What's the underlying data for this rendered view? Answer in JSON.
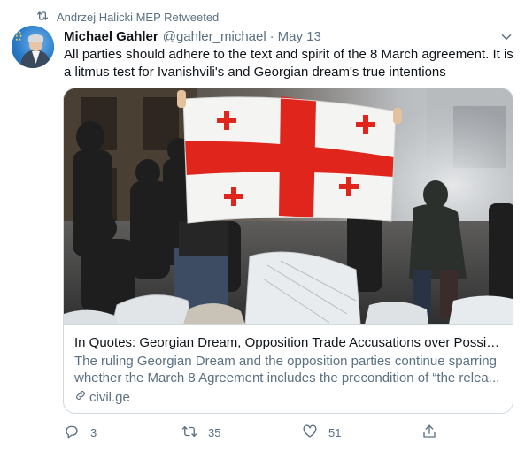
{
  "retweet": {
    "text": "Andrzej Halicki MEP Retweeted",
    "icon": "retweet-icon"
  },
  "author": {
    "name": "Michael Gahler",
    "handle": "@gahler_michael",
    "separator": "·",
    "date": "May 13"
  },
  "tweet": {
    "text": "All parties should adhere to the text and spirit of the 8 March agreement. It is a litmus test for Ivanishvili's and Georgian dream's true intentions"
  },
  "card": {
    "title": "In Quotes: Georgian Dream, Opposition Trade Accusations over Possible...",
    "description": "The ruling Georgian Dream and the opposition parties continue sparring whether the March 8 Agreement includes the precondition of “the relea...",
    "source": "civil.ge"
  },
  "actions": {
    "replies": "3",
    "retweets": "35",
    "likes": "51"
  },
  "colors": {
    "secondary_text": "#5b7083",
    "border": "#cfd9de",
    "flag_red": "#e0251c"
  }
}
